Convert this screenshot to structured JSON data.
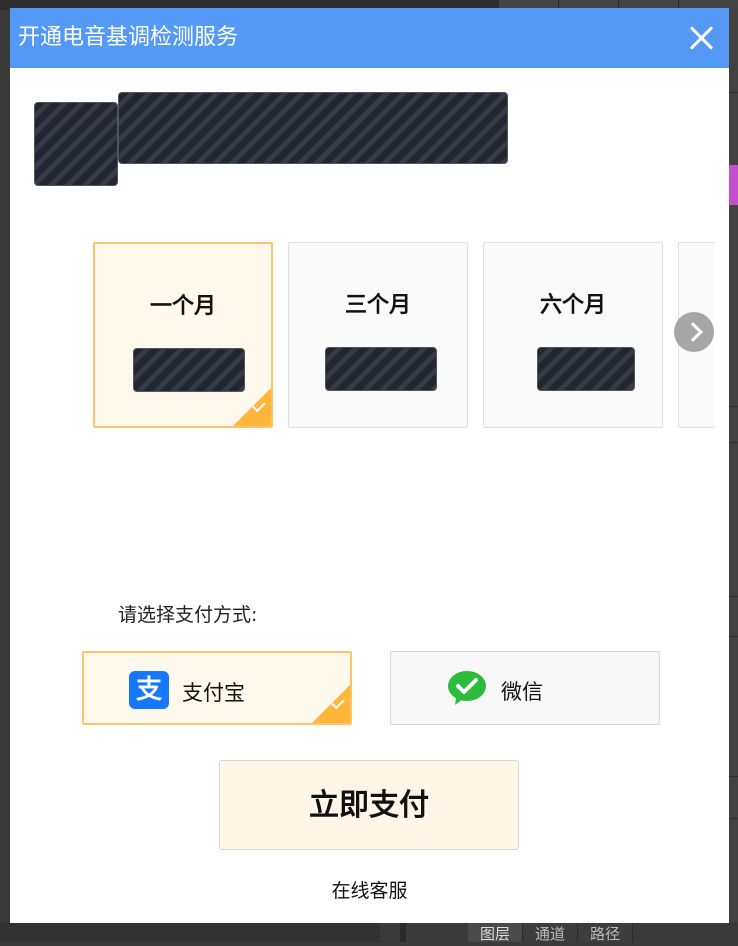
{
  "dialog": {
    "title": "开通电音基调检测服务"
  },
  "plans": [
    {
      "name": "一个月",
      "selected": true
    },
    {
      "name": "三个月",
      "selected": false
    },
    {
      "name": "六个月",
      "selected": false
    }
  ],
  "payment": {
    "label": "请选择支付方式:",
    "options": [
      {
        "name": "支付宝",
        "icon": "alipay-icon",
        "selected": true
      },
      {
        "name": "微信",
        "icon": "wechat-icon",
        "selected": false
      }
    ],
    "submit_label": "立即支付"
  },
  "support_label": "在线客服",
  "host_app": {
    "bottom_tabs": [
      "图层",
      "通道",
      "路径"
    ]
  },
  "colors": {
    "titlebar": "#5599f7",
    "accent": "#ffb53a",
    "selected_bg": "#fff8ec"
  }
}
